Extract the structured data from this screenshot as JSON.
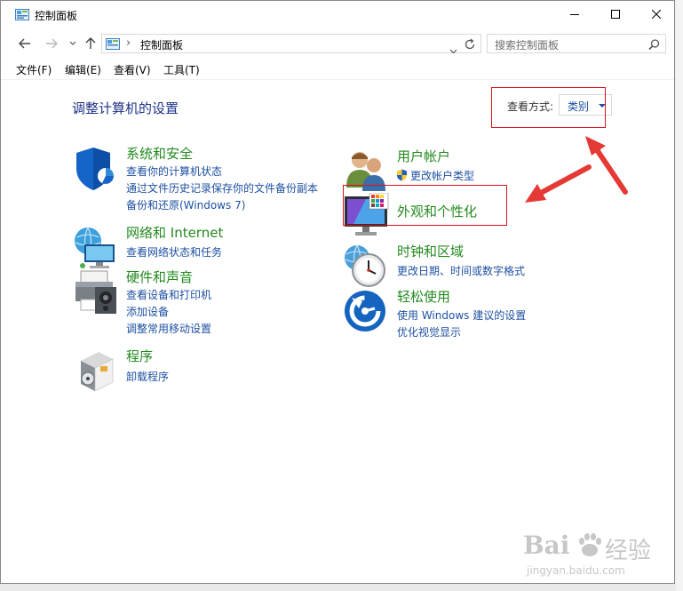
{
  "window": {
    "title": "控制面板",
    "controls": {
      "minimize": "minimize-icon",
      "maximize": "maximize-icon",
      "close": "close-icon"
    }
  },
  "address": {
    "path": "控制面板",
    "separator": "›"
  },
  "search": {
    "placeholder": "搜索控制面板"
  },
  "menu": [
    "文件(F)",
    "编辑(E)",
    "查看(V)",
    "工具(T)"
  ],
  "content": {
    "heading": "调整计算机的设置",
    "view_by_label": "查看方式:",
    "view_by_value": "类别",
    "categories": [
      {
        "title": "系统和安全",
        "links": [
          "查看你的计算机状态",
          "通过文件历史记录保存你的文件备份副本",
          "备份和还原(Windows 7)"
        ]
      },
      {
        "title": "网络和 Internet",
        "links": [
          "查看网络状态和任务"
        ]
      },
      {
        "title": "硬件和声音",
        "links": [
          "查看设备和打印机",
          "添加设备",
          "调整常用移动设置"
        ]
      },
      {
        "title": "程序",
        "links": [
          "卸载程序"
        ]
      },
      {
        "title": "用户帐户",
        "links": [
          "更改帐户类型"
        ]
      },
      {
        "title": "外观和个性化",
        "links": []
      },
      {
        "title": "时钟和区域",
        "links": [
          "更改日期、时间或数字格式"
        ]
      },
      {
        "title": "轻松使用",
        "links": [
          "使用 Windows 建议的设置",
          "优化视觉显示"
        ]
      }
    ]
  },
  "watermark": {
    "brand": "Bai",
    "brand_cn": "经验",
    "url": "jingyan.baidu.com"
  },
  "colors": {
    "category_title": "#238a1e",
    "link": "#1e50a2",
    "heading": "#1e3287",
    "annotation": "#d9131d"
  }
}
